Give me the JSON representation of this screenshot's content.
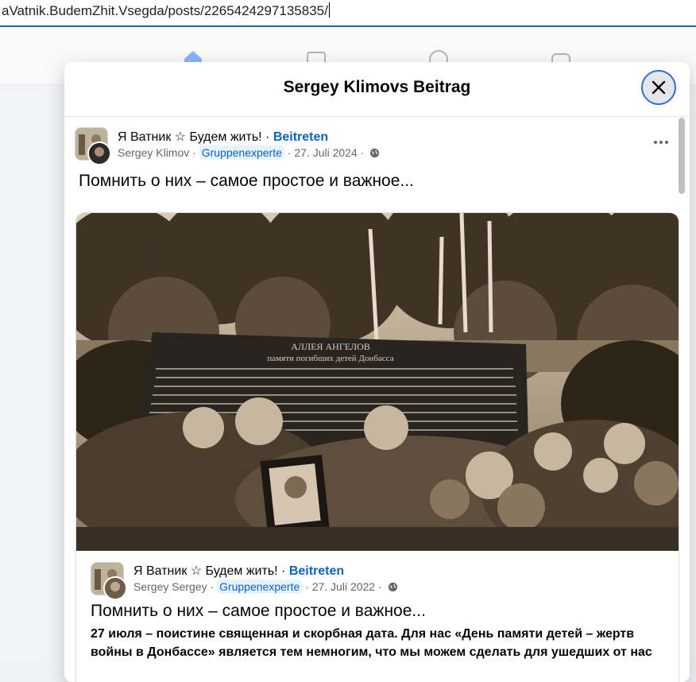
{
  "browser": {
    "address": "aVatnik.BudemZhit.Vsegda/posts/2265424297135835/"
  },
  "modal": {
    "title": "Sergey Klimovs Beitrag",
    "close_icon": "close-icon"
  },
  "post": {
    "group_name": "Я Ватник ☆ Будем жить!",
    "separator": " · ",
    "join_label": "Beitreten",
    "author": "Sergey Klimov",
    "badge": "Gruppenexperte",
    "date": "27. Juli 2024",
    "privacy_icon": "globe-icon",
    "text": "Помнить о них – самое простое и важное...",
    "more_icon": "more-dots-icon"
  },
  "shared_post": {
    "group_name": "Я Ватник ☆ Будем жить!",
    "separator": " · ",
    "join_label": "Beitreten",
    "author": "Sergey Sergey",
    "badge": "Gruppenexperte",
    "date": "27. Juli 2022",
    "text": "Помнить о них – самое простое и важное...",
    "body": "27 июля – поистине священная и скорбная дата. Для нас «День памяти детей – жертв войны в Донбассе» является тем немногим, что мы можем сделать для ушедших от нас"
  },
  "photo": {
    "memorial_title": "АЛЛЕЯ АНГЕЛОВ",
    "memorial_subtitle": "памяти погибших детей Донбасса",
    "tone": "#5a4a3a"
  },
  "colors": {
    "link": "#0a62c9",
    "focus_ring": "#2d6fd6"
  }
}
